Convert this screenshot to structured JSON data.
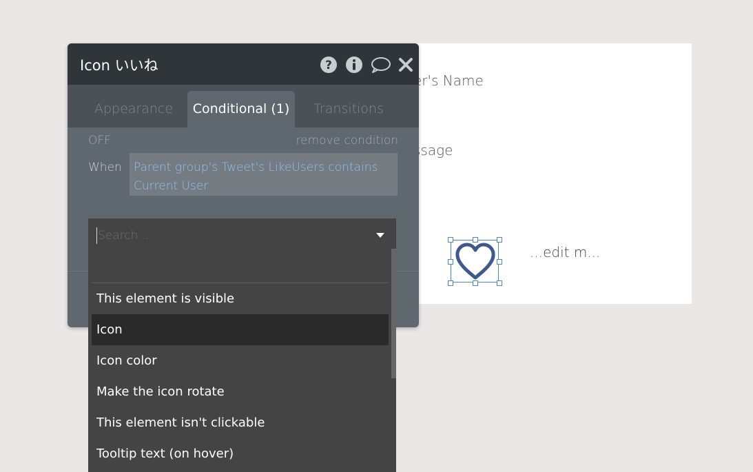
{
  "canvas": {
    "name_partial": "er's Name",
    "message_partial": "ssage",
    "edit_text": "...edit m..."
  },
  "panel": {
    "title": "Icon いいね",
    "header_icons": [
      "help-icon",
      "info-icon",
      "comment-icon",
      "close-icon"
    ],
    "tabs": [
      {
        "label": "Appearance",
        "active": false
      },
      {
        "label": "Conditional (1)",
        "active": true
      },
      {
        "label": "Transitions",
        "active": false
      }
    ],
    "off_label": "OFF",
    "remove_condition": "remove condition",
    "when_label": "When",
    "condition_expression": "Parent group's Tweet's LikeUsers contains Current User"
  },
  "dropdown": {
    "search_placeholder": "Search...",
    "options": [
      {
        "label": "This element is visible",
        "selected": false
      },
      {
        "label": "Icon",
        "selected": true
      },
      {
        "label": "Icon color",
        "selected": false
      },
      {
        "label": "Make the icon rotate",
        "selected": false
      },
      {
        "label": "This element isn't clickable",
        "selected": false
      },
      {
        "label": "Tooltip text (on hover)",
        "selected": false
      }
    ]
  },
  "colors": {
    "heart": "#3e5a8c",
    "selection": "#4a86c8",
    "link": "#8fc0f2"
  }
}
